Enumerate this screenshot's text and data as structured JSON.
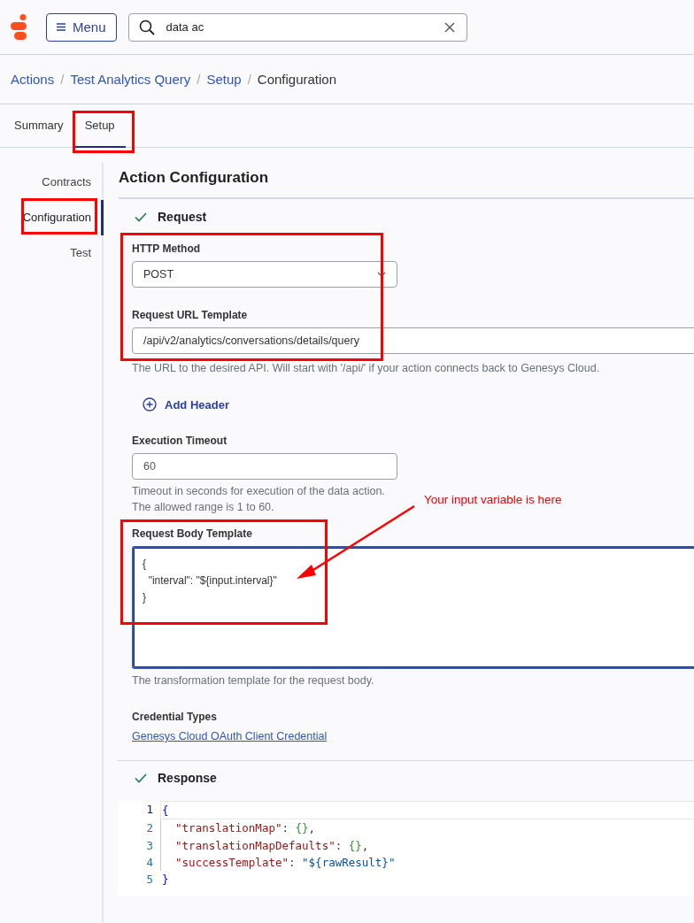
{
  "header": {
    "menu_label": "Menu",
    "search": {
      "value": "data ac"
    }
  },
  "breadcrumbs": [
    {
      "label": "Actions",
      "kind": "link"
    },
    {
      "label": "Test Analytics Query",
      "kind": "link",
      "separator": "/"
    },
    {
      "label": "Setup",
      "kind": "link",
      "separator": "/"
    },
    {
      "label": "Configuration",
      "kind": "current",
      "separator": "/"
    }
  ],
  "tabs": [
    {
      "label": "Summary",
      "selected": false
    },
    {
      "label": "Setup",
      "selected": true
    }
  ],
  "sidebar": {
    "items": [
      {
        "label": "Contracts",
        "selected": false
      },
      {
        "label": "Configuration",
        "selected": true
      },
      {
        "label": "Test",
        "selected": false
      }
    ]
  },
  "main": {
    "title": "Action Configuration",
    "request": {
      "title": "Request",
      "complete": true,
      "http_method": {
        "label": "HTTP Method",
        "value": "POST"
      },
      "url_template": {
        "label": "Request URL Template",
        "value": "/api/v2/analytics/conversations/details/query",
        "help": "The URL to the desired API. Will start with '/api/' if your action connects back to Genesys Cloud."
      },
      "add_header": "Add Header",
      "timeout": {
        "label": "Execution Timeout",
        "value": "60",
        "help": [
          "Timeout in seconds for execution of the data action.",
          "The allowed range is 1 to 60."
        ]
      },
      "body_template": {
        "label": "Request Body Template",
        "lines": [
          "{",
          "  \"interval\": \"${input.interval}\"",
          "}"
        ],
        "help": "The transformation template for the request body."
      },
      "credential": {
        "label": "Credential Types",
        "link": "Genesys Cloud OAuth Client Credential"
      }
    },
    "response": {
      "title": "Response",
      "complete": true,
      "code": [
        {
          "number": "1",
          "text": "{"
        },
        {
          "number": "2",
          "text": "  \"translationMap\": {},"
        },
        {
          "number": "3",
          "text": "  \"translationMapDefaults\": {},"
        },
        {
          "number": "4",
          "text": "  \"successTemplate\": \"${rawResult}\""
        },
        {
          "number": "5",
          "text": "}"
        }
      ]
    }
  },
  "annotation": {
    "text": "Your input variable is here"
  }
}
